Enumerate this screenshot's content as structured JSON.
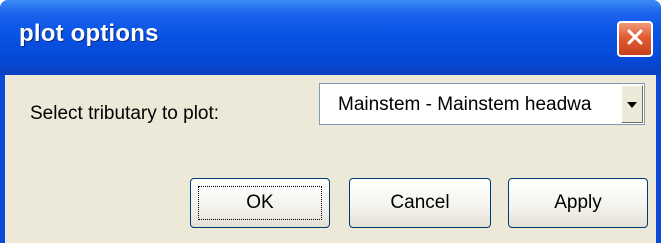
{
  "window": {
    "title": "plot options"
  },
  "form": {
    "tributary_label": "Select tributary to plot:",
    "tributary_selected": "Mainstem - Mainstem headwa"
  },
  "buttons": {
    "ok": "OK",
    "cancel": "Cancel",
    "apply": "Apply"
  },
  "icons": {
    "close": "close-icon",
    "dropdown": "chevron-down-icon"
  },
  "colors": {
    "titlebar": "#0a53e4",
    "close_button": "#e25b33",
    "dialog_background": "#ece9d8"
  }
}
